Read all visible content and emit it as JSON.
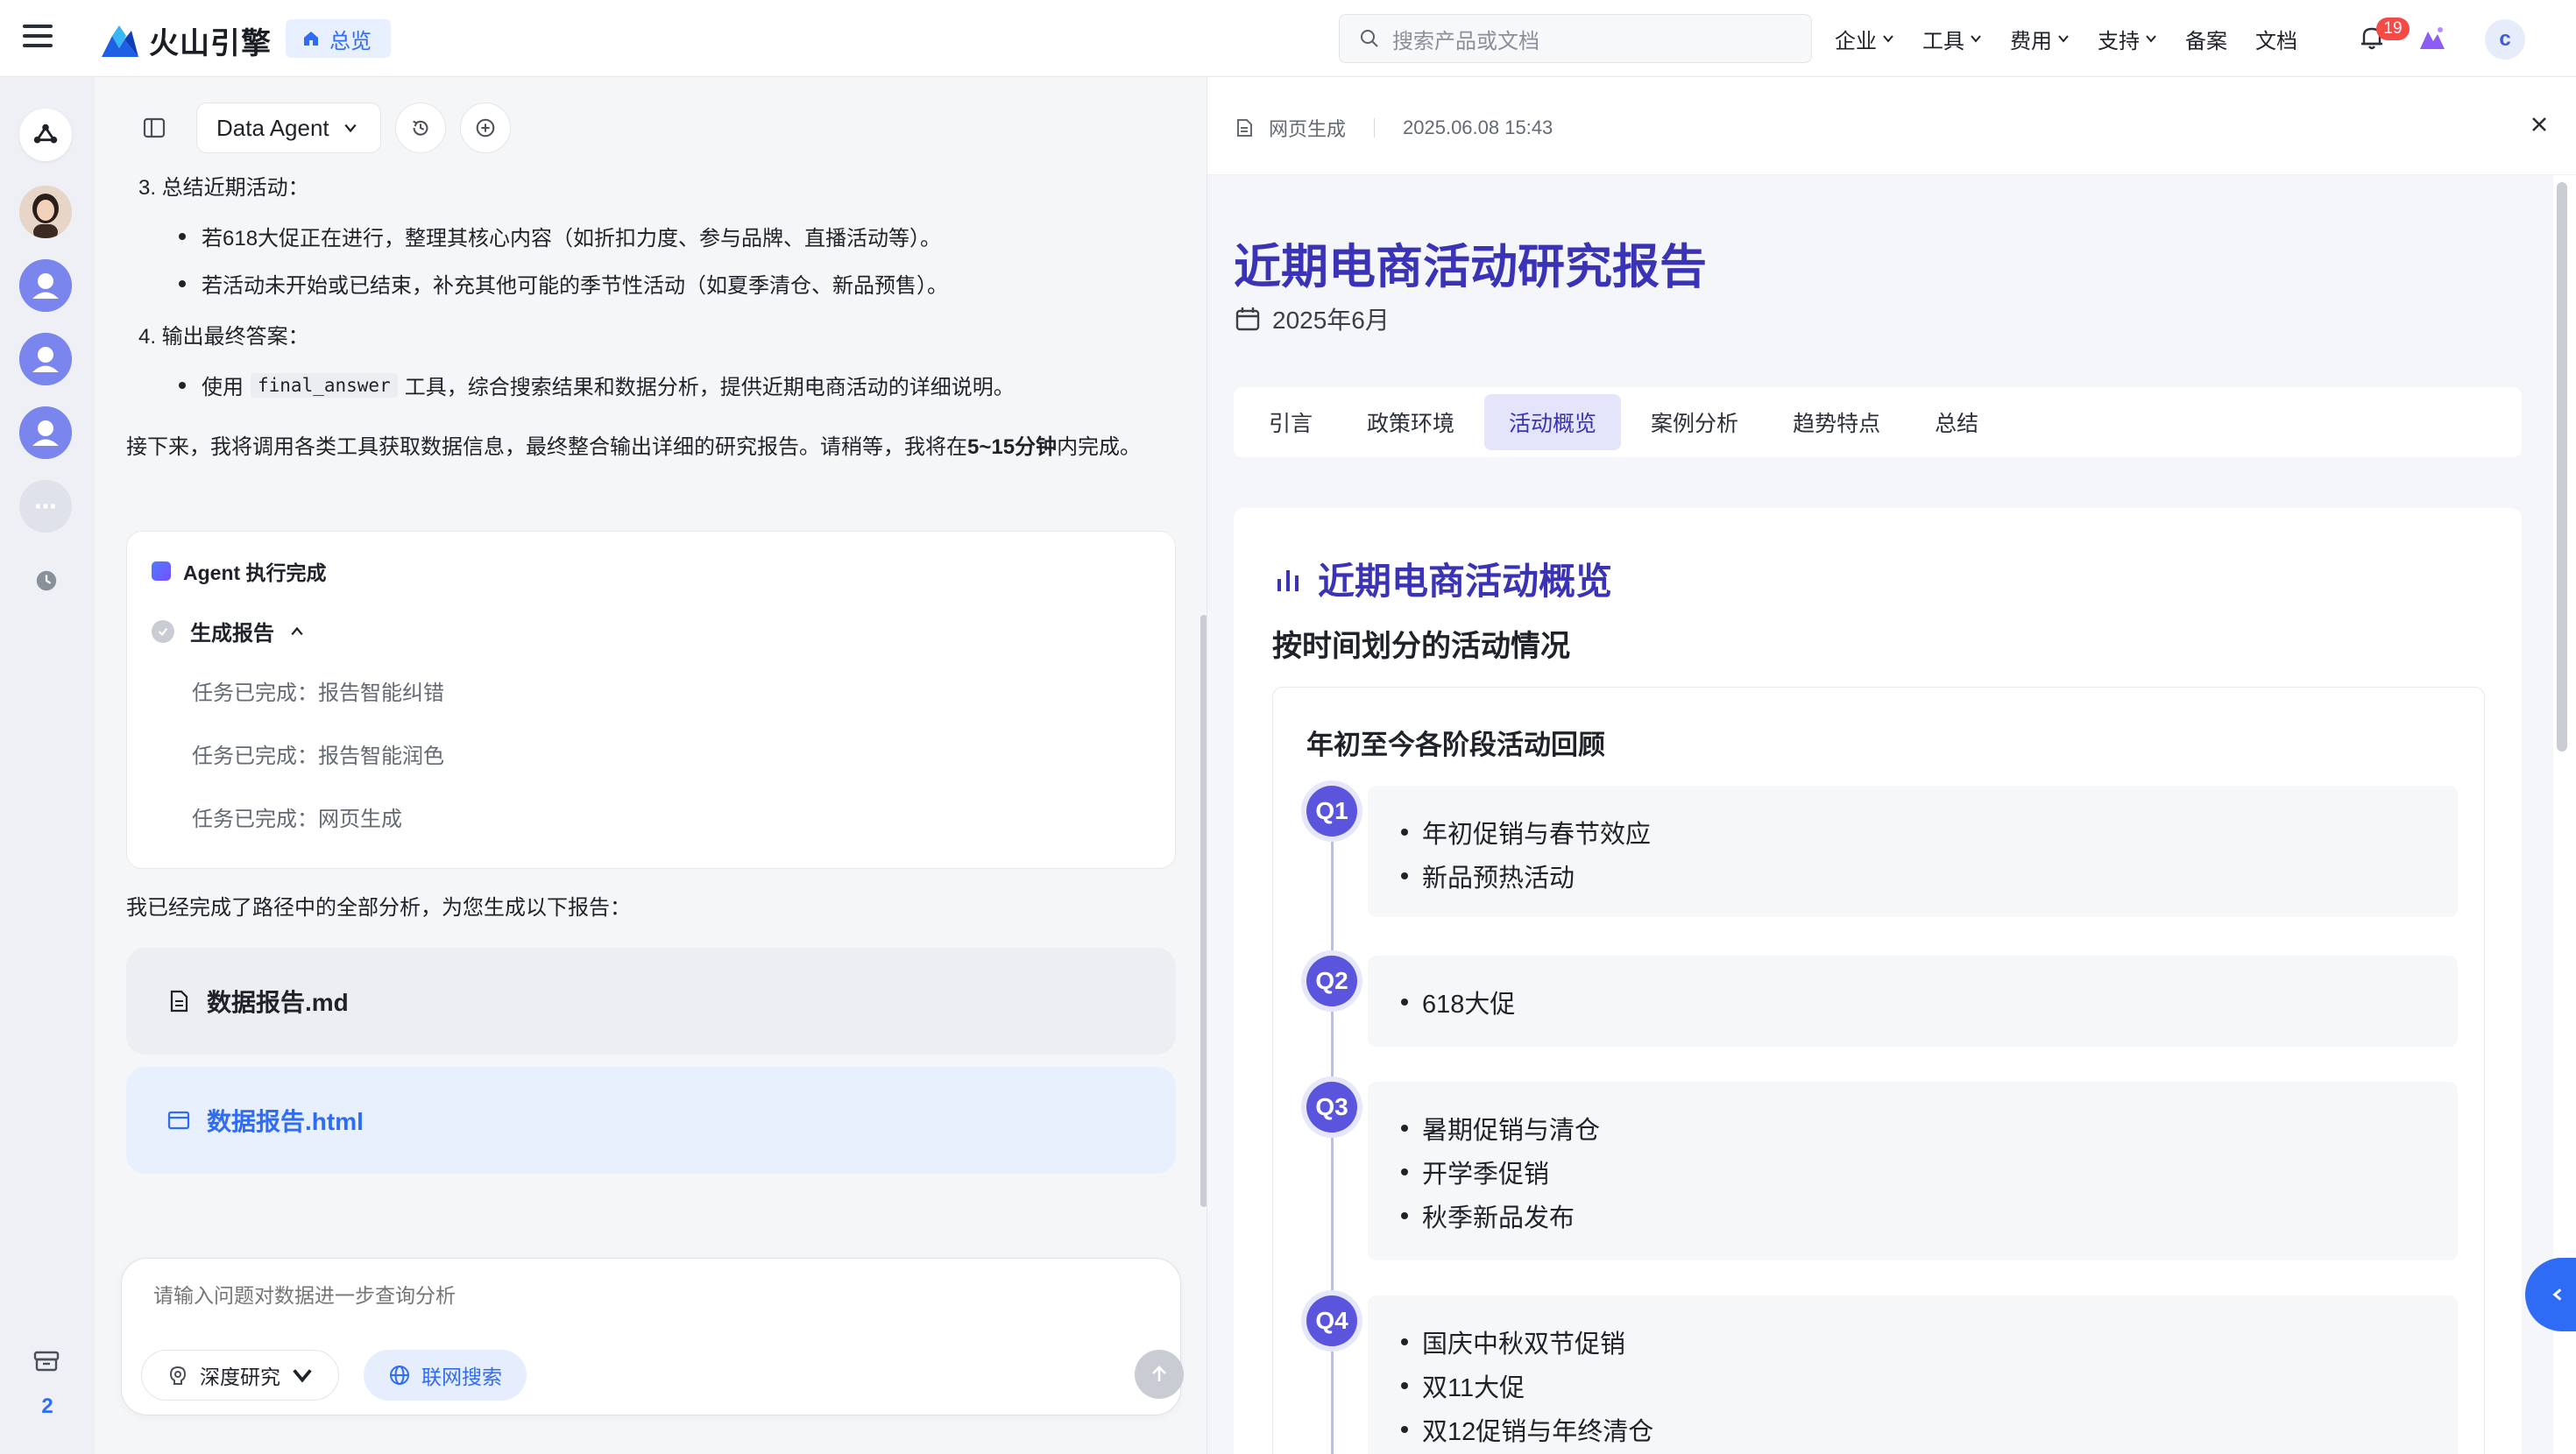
{
  "topnav": {
    "brand": "火山引擎",
    "overview": "总览",
    "search_placeholder": "搜索产品或文档",
    "links": [
      {
        "label": "企业",
        "dropdown": true
      },
      {
        "label": "工具",
        "dropdown": true
      },
      {
        "label": "费用",
        "dropdown": true
      },
      {
        "label": "支持",
        "dropdown": true
      },
      {
        "label": "备案",
        "dropdown": false
      },
      {
        "label": "文档",
        "dropdown": false
      }
    ],
    "notifications": "19",
    "user_initial": "c"
  },
  "rail": {
    "archive_count": "2"
  },
  "chat": {
    "agent_name": "Data Agent",
    "steps": {
      "step3_heading": "3. 总结近期活动：",
      "step3_b1": "若618大促正在进行，整理其核心内容（如折扣力度、参与品牌、直播活动等）。",
      "step3_b2": "若活动未开始或已结束，补充其他可能的季节性活动（如夏季清仓、新品预售）。",
      "step4_heading": "4. 输出最终答案：",
      "step4_b1_pre": "使用",
      "step4_b1_code": "final_answer",
      "step4_b1_post": "工具，综合搜索结果和数据分析，提供近期电商活动的详细说明。"
    },
    "para_pre": "接下来，我将调用各类工具获取数据信息，最终整合输出详细的研究报告。请稍等，我将在",
    "para_bold": "5~15分钟",
    "para_post": "内完成。",
    "agent_card": {
      "title": "Agent 执行完成",
      "step": "生成报告",
      "tasks": [
        "任务已完成：报告智能纠错",
        "任务已完成：报告智能润色",
        "任务已完成：网页生成"
      ]
    },
    "done_text": "我已经完成了路径中的全部分析，为您生成以下报告：",
    "files": [
      "数据报告.md",
      "数据报告.html"
    ],
    "input_placeholder": "请输入问题对数据进一步查询分析",
    "chip_deep": "深度研究",
    "chip_web": "联网搜索"
  },
  "report": {
    "meta_type": "网页生成",
    "meta_time": "2025.06.08 15:43",
    "title": "近期电商活动研究报告",
    "date": "2025年6月",
    "tabs": [
      "引言",
      "政策环境",
      "活动概览",
      "案例分析",
      "趋势特点",
      "总结"
    ],
    "active_tab": "活动概览",
    "section_title": "近期电商活动概览",
    "section_sub": "按时间划分的活动情况",
    "timeline_title": "年初至今各阶段活动回顾",
    "quarters": [
      {
        "label": "Q1",
        "items": [
          "年初促销与春节效应",
          "新品预热活动"
        ]
      },
      {
        "label": "Q2",
        "items": [
          "618大促"
        ]
      },
      {
        "label": "Q3",
        "items": [
          "暑期促销与清仓",
          "开学季促销",
          "秋季新品发布"
        ]
      },
      {
        "label": "Q4",
        "items": [
          "国庆中秋双节促销",
          "双11大促",
          "双12促销与年终清仓"
        ]
      }
    ]
  },
  "colors": {
    "accent": "#2f6cf6",
    "report_title": "#3b33b5",
    "quarter_dot": "#5a55dc",
    "badge": "#f54a45"
  }
}
